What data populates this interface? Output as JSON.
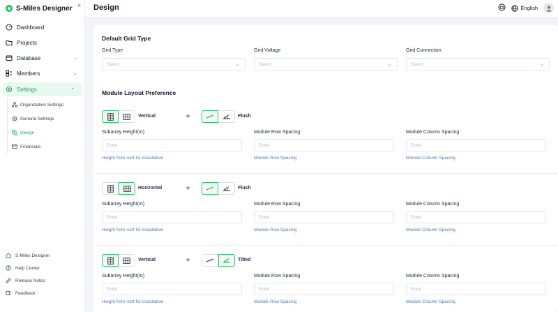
{
  "app": {
    "name": "S-Miles Designer"
  },
  "nav": {
    "dashboard": "Dashboard",
    "projects": "Projects",
    "database": "Database",
    "members": "Members",
    "settings": "Settings",
    "sub": {
      "organization": "Organization Settings",
      "general": "General Settings",
      "design": "Design",
      "financials": "Financials"
    }
  },
  "bottom": {
    "designer": "S-Miles Designer",
    "help": "Help Center",
    "release": "Release Notes",
    "feedback": "Feedback"
  },
  "header": {
    "title": "Design",
    "language": "English"
  },
  "grid": {
    "title": "Default Grid Type",
    "type_label": "Grid Type",
    "voltage_label": "Grid Voltage",
    "connection_label": "Grid Connection",
    "placeholder": "Select"
  },
  "layout": {
    "title": "Module Layout Preference",
    "rows": [
      {
        "orientation": "Vertical",
        "mount": "Flush",
        "height_label": "Subarray Height(m)",
        "row_spacing_label": "Module Row Spacing",
        "col_spacing_label": "Module Column Spacing",
        "placeholder": "Enter",
        "height_hint": "Height from roof for installation",
        "row_hint": "Module Row Spacing",
        "col_hint": "Module Column Spacing"
      },
      {
        "orientation": "Horizontal",
        "mount": "Flush",
        "height_label": "Subarray Height(m)",
        "row_spacing_label": "Module Row Spacing",
        "col_spacing_label": "Module Column Spacing",
        "placeholder": "Enter",
        "height_hint": "Height from roof for installation",
        "row_hint": "Module Row Spacing",
        "col_hint": "Module Column Spacing"
      },
      {
        "orientation": "Vertical",
        "mount": "Tilted",
        "height_label": "Subarray Height(m)",
        "row_spacing_label": "Module Row Spacing",
        "col_spacing_label": "Module Column Spacing",
        "placeholder": "Enter",
        "height_hint": "Height from roof for installation",
        "row_hint": "Module Row Spacing",
        "col_hint": "Module Column Spacing"
      }
    ]
  },
  "colors": {
    "accent": "#22a454",
    "accent_bg": "#eaf9ef",
    "hint": "#5b79a8"
  }
}
